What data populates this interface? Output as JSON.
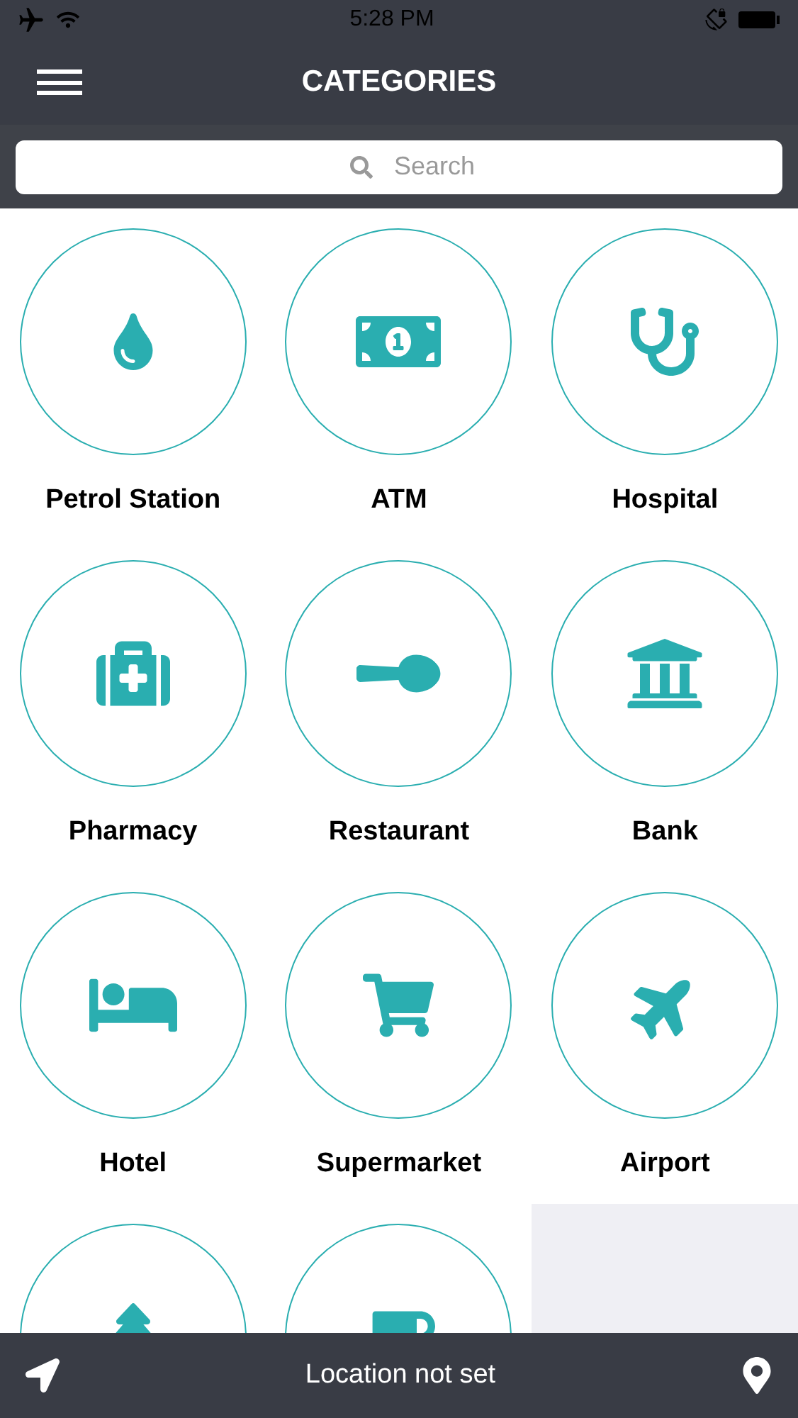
{
  "status_bar": {
    "time": "5:28 PM"
  },
  "header": {
    "title": "CATEGORIES"
  },
  "search": {
    "placeholder": "Search"
  },
  "categories": [
    {
      "kind": "labeled",
      "label": "Petrol Station"
    },
    {
      "kind": "labeled",
      "label": "ATM"
    },
    {
      "kind": "labeled",
      "label": "Hospital"
    },
    {
      "kind": "labeled",
      "label": "Pharmacy"
    },
    {
      "kind": "labeled",
      "label": "Restaurant"
    },
    {
      "kind": "labeled",
      "label": "Bank"
    },
    {
      "kind": "labeled",
      "label": "Hotel"
    },
    {
      "kind": "labeled",
      "label": "Supermarket"
    },
    {
      "kind": "labeled",
      "label": "Airport"
    },
    {
      "kind": "clipped"
    },
    {
      "kind": "clipped"
    }
  ],
  "footer": {
    "location": "Location not set"
  }
}
